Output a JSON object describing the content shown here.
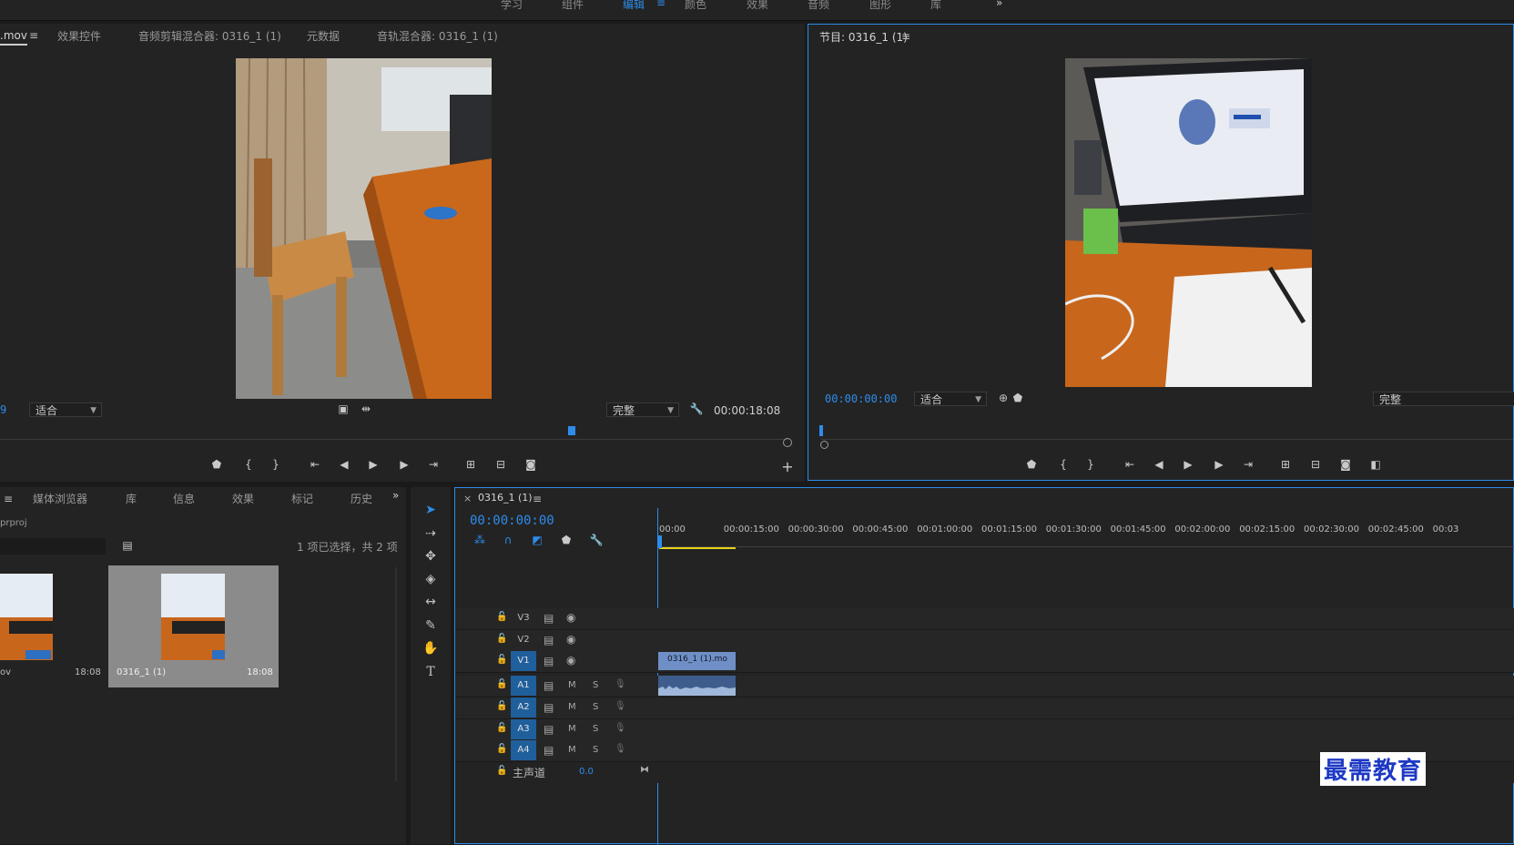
{
  "workspaces": [
    "学习",
    "组件",
    "编辑",
    "颜色",
    "效果",
    "音频",
    "图形",
    "库"
  ],
  "workspace_active_index": 2,
  "workspace_overflow": "»",
  "source_panel": {
    "tabs": [
      ".mov",
      "效果控件",
      "音频剪辑混合器: 0316_1 (1)",
      "元数据",
      "音轨混合器: 0316_1 (1)"
    ],
    "tc_left": "9",
    "fit": "适合",
    "quality": "完整",
    "duration": "00:00:18:08",
    "menu_icon": "≡"
  },
  "program_panel": {
    "title": "节目: 0316_1 (1)",
    "timecode": "00:00:00:00",
    "fit": "适合",
    "quality": "完整"
  },
  "project_panel": {
    "tabs": [
      "媒体浏览器",
      "库",
      "信息",
      "效果",
      "标记",
      "历史"
    ],
    "project_name": "prproj",
    "status": "1 项已选择，共 2 项",
    "items": [
      {
        "name": "ov",
        "duration": "18:08"
      },
      {
        "name": "0316_1 (1)",
        "duration": "18:08"
      }
    ]
  },
  "timeline": {
    "sequence_tab": "0316_1 (1)",
    "close": "×",
    "timecode": "00:00:00:00",
    "ruler_labels": [
      "00:00",
      "00:00:15:00",
      "00:00:30:00",
      "00:00:45:00",
      "00:01:00:00",
      "00:01:15:00",
      "00:01:30:00",
      "00:01:45:00",
      "00:02:00:00",
      "00:02:15:00",
      "00:02:30:00",
      "00:02:45:00",
      "00:03"
    ],
    "video_tracks": [
      "V3",
      "V2",
      "V1"
    ],
    "audio_tracks": [
      "A1",
      "A2",
      "A3",
      "A4"
    ],
    "mute_label": "M",
    "solo_label": "S",
    "master_label": "主声道",
    "master_value": "0.0",
    "clip_name": "0316_1 (1).mo"
  },
  "watermark": "最需教育",
  "colors": {
    "accent": "#2d8ceb",
    "track_on": "#1f5f9c",
    "clip": "#6f8fc6",
    "watermark": "#1d39c4"
  }
}
